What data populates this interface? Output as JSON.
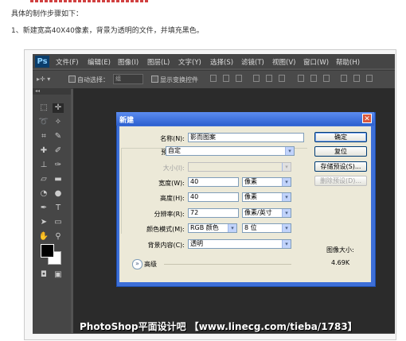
{
  "article": {
    "intro": "具体的制作步骤如下：",
    "step1": "1、新建宽高40X40像素，背景为透明的文件，并填充黑色。"
  },
  "ps": {
    "logo": "Ps",
    "menu": [
      "文件(F)",
      "编辑(E)",
      "图像(I)",
      "图层(L)",
      "文字(Y)",
      "选择(S)",
      "滤镜(T)",
      "视图(V)",
      "窗口(W)",
      "帮助(H)"
    ],
    "options": {
      "auto_select_label": "自动选择：",
      "auto_select_value": "组",
      "show_transform_label": "显示变换控件"
    },
    "toolbox_header": "◂◂"
  },
  "dialog": {
    "title": "新建",
    "close": "✕",
    "name_label": "名称(N):",
    "name_value": "影而图案",
    "preset_label": "预设(P):",
    "preset_value": "自定",
    "size_label": "大小(I):",
    "size_value": "",
    "width_label": "宽度(W):",
    "width_value": "40",
    "width_unit": "像素",
    "height_label": "高度(H):",
    "height_value": "40",
    "height_unit": "像素",
    "resolution_label": "分辨率(R):",
    "resolution_value": "72",
    "resolution_unit": "像素/英寸",
    "colormode_label": "颜色模式(M):",
    "colormode_value": "RGB 颜色",
    "bitdepth_value": "8 位",
    "bgcontent_label": "背景内容(C):",
    "bgcontent_value": "透明",
    "advanced_label": "高级",
    "ok_button": "确定",
    "reset_button": "复位",
    "save_preset_button": "存储预设(S)...",
    "delete_preset_button": "删除预设(D)...",
    "image_size_label": "图像大小:",
    "image_size_value": "4.69K"
  },
  "watermark": "PhotoShop平面设计吧 【www.linecg.com/tieba/1783】",
  "icons": {
    "dropdown": "▾",
    "advanced_toggle": "»"
  }
}
